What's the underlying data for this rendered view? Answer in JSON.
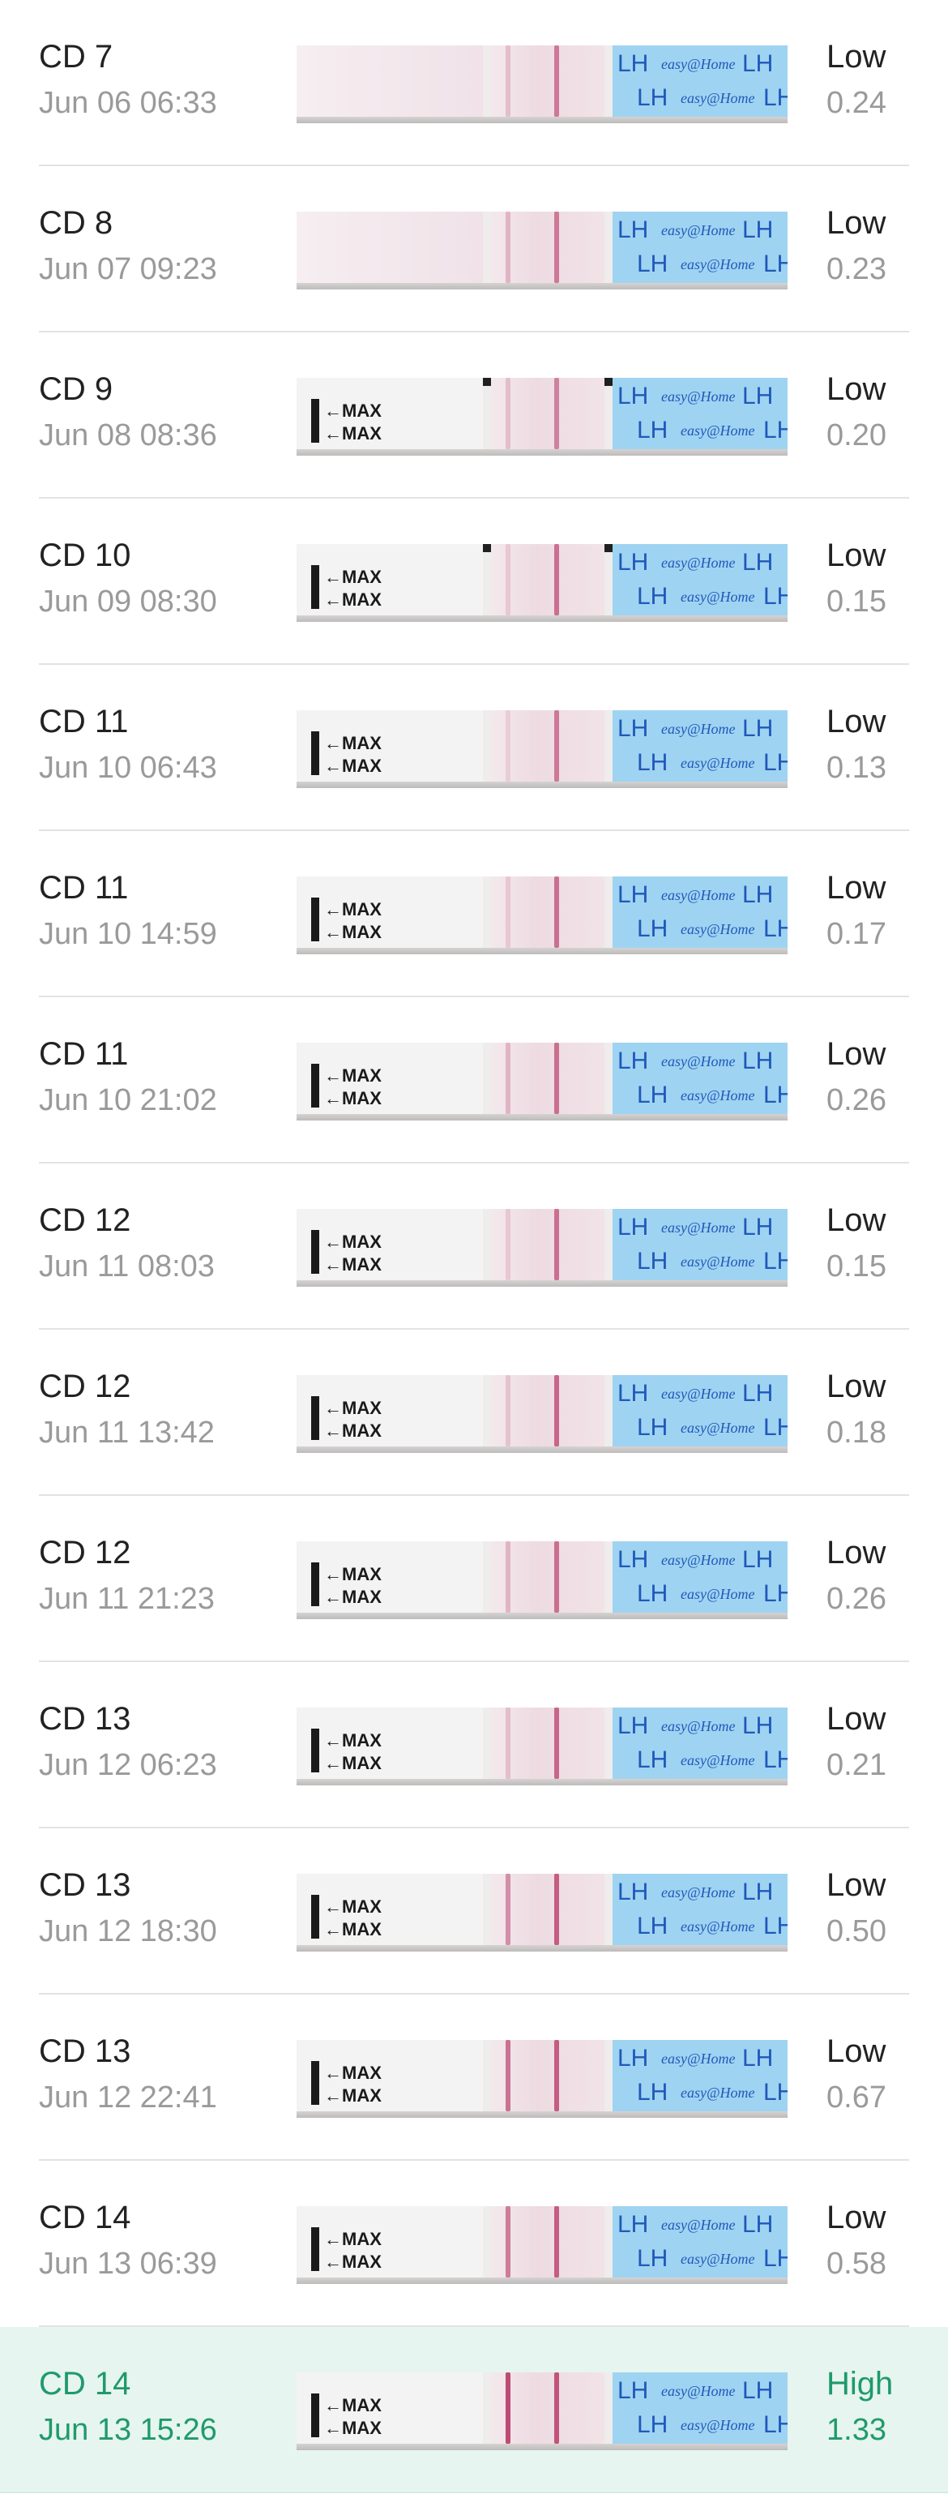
{
  "colors": {
    "highlight_bg": "#e6f5ef",
    "highlight_text": "#1f9a6c",
    "primary_text": "#222222",
    "secondary_text": "#9a9a9a",
    "strip_blue": "#9fd3f2",
    "strip_print": "#1f59b9"
  },
  "strip_print": {
    "lh": "LH",
    "brand": "easy@Home",
    "max": "←MAX"
  },
  "tests": [
    {
      "cycle_day": "CD 7",
      "datetime": "Jun 06 06:33",
      "result": "Low",
      "ratio": "0.24",
      "highlighted": false,
      "test_line_intensity": 0.55,
      "control_line_intensity": 0.2,
      "has_handle": false
    },
    {
      "cycle_day": "CD 8",
      "datetime": "Jun 07 09:23",
      "result": "Low",
      "ratio": "0.23",
      "highlighted": false,
      "test_line_intensity": 0.55,
      "control_line_intensity": 0.25,
      "has_handle": false
    },
    {
      "cycle_day": "CD 9",
      "datetime": "Jun 08 08:36",
      "result": "Low",
      "ratio": "0.20",
      "highlighted": false,
      "test_line_intensity": 0.5,
      "control_line_intensity": 0.2,
      "has_handle": true
    },
    {
      "cycle_day": "CD 10",
      "datetime": "Jun 09 08:30",
      "result": "Low",
      "ratio": "0.15",
      "highlighted": false,
      "test_line_intensity": 0.6,
      "control_line_intensity": 0.15,
      "has_handle": true
    },
    {
      "cycle_day": "CD 11",
      "datetime": "Jun 10 06:43",
      "result": "Low",
      "ratio": "0.13",
      "highlighted": false,
      "test_line_intensity": 0.55,
      "control_line_intensity": 0.12,
      "has_handle": true
    },
    {
      "cycle_day": "CD 11",
      "datetime": "Jun 10 14:59",
      "result": "Low",
      "ratio": "0.17",
      "highlighted": false,
      "test_line_intensity": 0.6,
      "control_line_intensity": 0.15,
      "has_handle": true
    },
    {
      "cycle_day": "CD 11",
      "datetime": "Jun 10 21:02",
      "result": "Low",
      "ratio": "0.26",
      "highlighted": false,
      "test_line_intensity": 0.6,
      "control_line_intensity": 0.25,
      "has_handle": true
    },
    {
      "cycle_day": "CD 12",
      "datetime": "Jun 11 08:03",
      "result": "Low",
      "ratio": "0.15",
      "highlighted": false,
      "test_line_intensity": 0.6,
      "control_line_intensity": 0.15,
      "has_handle": true
    },
    {
      "cycle_day": "CD 12",
      "datetime": "Jun 11 13:42",
      "result": "Low",
      "ratio": "0.18",
      "highlighted": false,
      "test_line_intensity": 0.65,
      "control_line_intensity": 0.18,
      "has_handle": true
    },
    {
      "cycle_day": "CD 12",
      "datetime": "Jun 11 21:23",
      "result": "Low",
      "ratio": "0.26",
      "highlighted": false,
      "test_line_intensity": 0.6,
      "control_line_intensity": 0.25,
      "has_handle": true
    },
    {
      "cycle_day": "CD 13",
      "datetime": "Jun 12 06:23",
      "result": "Low",
      "ratio": "0.21",
      "highlighted": false,
      "test_line_intensity": 0.65,
      "control_line_intensity": 0.2,
      "has_handle": true
    },
    {
      "cycle_day": "CD 13",
      "datetime": "Jun 12 18:30",
      "result": "Low",
      "ratio": "0.50",
      "highlighted": false,
      "test_line_intensity": 0.7,
      "control_line_intensity": 0.45,
      "has_handle": true
    },
    {
      "cycle_day": "CD 13",
      "datetime": "Jun 12 22:41",
      "result": "Low",
      "ratio": "0.67",
      "highlighted": false,
      "test_line_intensity": 0.7,
      "control_line_intensity": 0.6,
      "has_handle": true
    },
    {
      "cycle_day": "CD 14",
      "datetime": "Jun 13 06:39",
      "result": "Low",
      "ratio": "0.58",
      "highlighted": false,
      "test_line_intensity": 0.7,
      "control_line_intensity": 0.55,
      "has_handle": true
    },
    {
      "cycle_day": "CD 14",
      "datetime": "Jun 13 15:26",
      "result": "High",
      "ratio": "1.33",
      "highlighted": true,
      "test_line_intensity": 0.75,
      "control_line_intensity": 0.8,
      "has_handle": true
    }
  ]
}
